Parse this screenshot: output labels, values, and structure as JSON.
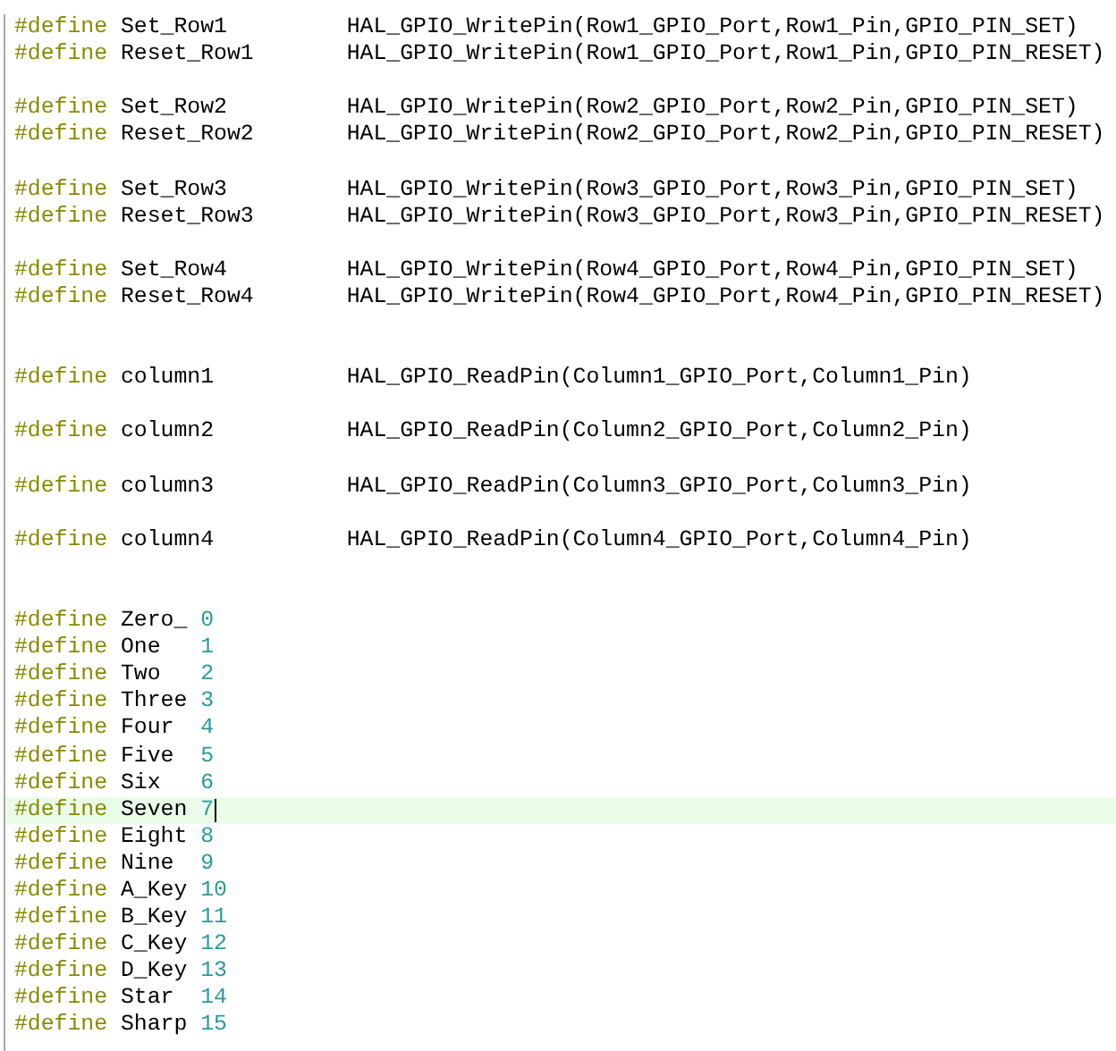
{
  "lines": [
    {
      "kind": "macro",
      "directive": "#define",
      "name": "Set_Row1",
      "value": "HAL_GPIO_WritePin(Row1_GPIO_Port,Row1_Pin,GPIO_PIN_SET)",
      "current": false
    },
    {
      "kind": "macro",
      "directive": "#define",
      "name": "Reset_Row1",
      "value": "HAL_GPIO_WritePin(Row1_GPIO_Port,Row1_Pin,GPIO_PIN_RESET)",
      "current": false
    },
    {
      "kind": "blank"
    },
    {
      "kind": "macro",
      "directive": "#define",
      "name": "Set_Row2",
      "value": "HAL_GPIO_WritePin(Row2_GPIO_Port,Row2_Pin,GPIO_PIN_SET)",
      "current": false
    },
    {
      "kind": "macro",
      "directive": "#define",
      "name": "Reset_Row2",
      "value": "HAL_GPIO_WritePin(Row2_GPIO_Port,Row2_Pin,GPIO_PIN_RESET)",
      "current": false
    },
    {
      "kind": "blank"
    },
    {
      "kind": "macro",
      "directive": "#define",
      "name": "Set_Row3",
      "value": "HAL_GPIO_WritePin(Row3_GPIO_Port,Row3_Pin,GPIO_PIN_SET)",
      "current": false
    },
    {
      "kind": "macro",
      "directive": "#define",
      "name": "Reset_Row3",
      "value": "HAL_GPIO_WritePin(Row3_GPIO_Port,Row3_Pin,GPIO_PIN_RESET)",
      "current": false
    },
    {
      "kind": "blank"
    },
    {
      "kind": "macro",
      "directive": "#define",
      "name": "Set_Row4",
      "value": "HAL_GPIO_WritePin(Row4_GPIO_Port,Row4_Pin,GPIO_PIN_SET)",
      "current": false
    },
    {
      "kind": "macro",
      "directive": "#define",
      "name": "Reset_Row4",
      "value": "HAL_GPIO_WritePin(Row4_GPIO_Port,Row4_Pin,GPIO_PIN_RESET)",
      "current": false
    },
    {
      "kind": "blank"
    },
    {
      "kind": "blank"
    },
    {
      "kind": "macro",
      "directive": "#define",
      "name": "column1",
      "value": "HAL_GPIO_ReadPin(Column1_GPIO_Port,Column1_Pin)",
      "current": false
    },
    {
      "kind": "blank"
    },
    {
      "kind": "macro",
      "directive": "#define",
      "name": "column2",
      "value": "HAL_GPIO_ReadPin(Column2_GPIO_Port,Column2_Pin)",
      "current": false
    },
    {
      "kind": "blank"
    },
    {
      "kind": "macro",
      "directive": "#define",
      "name": "column3",
      "value": "HAL_GPIO_ReadPin(Column3_GPIO_Port,Column3_Pin)",
      "current": false
    },
    {
      "kind": "blank"
    },
    {
      "kind": "macro",
      "directive": "#define",
      "name": "column4",
      "value": "HAL_GPIO_ReadPin(Column4_GPIO_Port,Column4_Pin)",
      "current": false
    },
    {
      "kind": "blank"
    },
    {
      "kind": "blank"
    },
    {
      "kind": "constant",
      "directive": "#define",
      "name": "Zero_",
      "value": "0",
      "current": false
    },
    {
      "kind": "constant",
      "directive": "#define",
      "name": "One",
      "value": "1",
      "current": false
    },
    {
      "kind": "constant",
      "directive": "#define",
      "name": "Two",
      "value": "2",
      "current": false
    },
    {
      "kind": "constant",
      "directive": "#define",
      "name": "Three",
      "value": "3",
      "current": false
    },
    {
      "kind": "constant",
      "directive": "#define",
      "name": "Four",
      "value": "4",
      "current": false
    },
    {
      "kind": "constant",
      "directive": "#define",
      "name": "Five",
      "value": "5",
      "current": false
    },
    {
      "kind": "constant",
      "directive": "#define",
      "name": "Six",
      "value": "6",
      "current": false
    },
    {
      "kind": "constant",
      "directive": "#define",
      "name": "Seven",
      "value": "7",
      "current": true
    },
    {
      "kind": "constant",
      "directive": "#define",
      "name": "Eight",
      "value": "8",
      "current": false
    },
    {
      "kind": "constant",
      "directive": "#define",
      "name": "Nine",
      "value": "9",
      "current": false
    },
    {
      "kind": "constant",
      "directive": "#define",
      "name": "A_Key",
      "value": "10",
      "current": false
    },
    {
      "kind": "constant",
      "directive": "#define",
      "name": "B_Key",
      "value": "11",
      "current": false
    },
    {
      "kind": "constant",
      "directive": "#define",
      "name": "C_Key",
      "value": "12",
      "current": false
    },
    {
      "kind": "constant",
      "directive": "#define",
      "name": "D_Key",
      "value": "13",
      "current": false
    },
    {
      "kind": "constant",
      "directive": "#define",
      "name": "Star",
      "value": "14",
      "current": false
    },
    {
      "kind": "constant",
      "directive": "#define",
      "name": "Sharp",
      "value": "15",
      "current": false
    }
  ]
}
